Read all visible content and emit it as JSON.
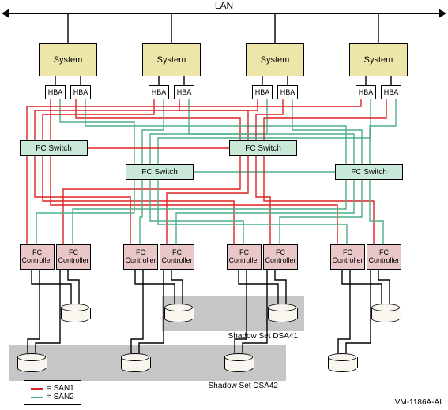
{
  "lan_label": "LAN",
  "system_label": "System",
  "hba_label": "HBA",
  "fc_switch_label": "FC Switch",
  "fc_controller_label": "FC\nController",
  "shadow_set_1": "Shadow Set DSA41",
  "shadow_set_2": "Shadow Set DSA42",
  "legend": {
    "san1": "= SAN1",
    "san2": "= SAN2"
  },
  "image_id": "VM-1186A-AI"
}
